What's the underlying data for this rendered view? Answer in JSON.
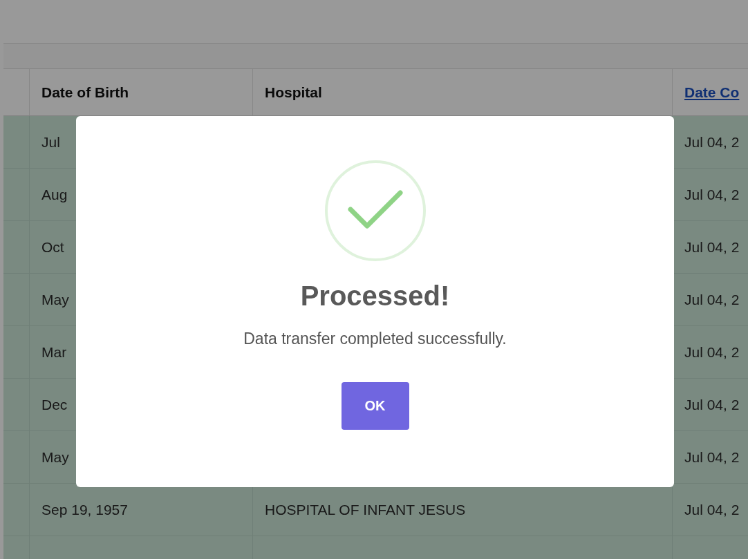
{
  "table": {
    "columns": [
      {
        "label": "Date of Birth",
        "kind": "plain"
      },
      {
        "label": "Hospital",
        "kind": "plain"
      },
      {
        "label": "Date Co",
        "kind": "link"
      }
    ],
    "rows": [
      {
        "birth": "Jul",
        "completed": "Jul 04, 2"
      },
      {
        "birth": "Aug",
        "completed": "Jul 04, 2"
      },
      {
        "birth": "Oct",
        "completed": "Jul 04, 2"
      },
      {
        "birth": "May",
        "completed": "Jul 04, 2"
      },
      {
        "birth": "Mar",
        "completed": "Jul 04, 2"
      },
      {
        "birth": "Dec",
        "completed": "Jul 04, 2"
      },
      {
        "birth": "May",
        "completed": "Jul 04, 2"
      },
      {
        "birth": "Sep 19, 1957",
        "hospital": "HOSPITAL OF INFANT JESUS",
        "completed": "Jul 04, 2"
      }
    ]
  },
  "dialog": {
    "kind": "success",
    "title": "Processed!",
    "message": "Data transfer completed successfully.",
    "button": "OK"
  }
}
